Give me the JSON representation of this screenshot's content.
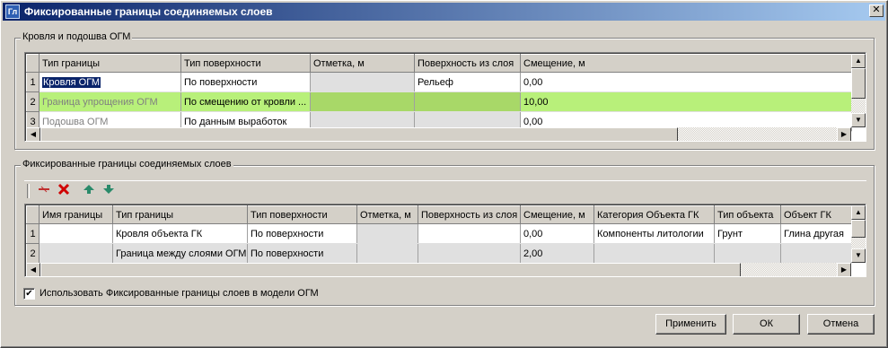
{
  "window": {
    "title": "Фиксированные границы соединяемых слоев",
    "icon_text": "Гл",
    "close_glyph": "✕"
  },
  "group_top": {
    "label": "Кровля и подошва ОГМ",
    "columns": [
      "Тип границы",
      "Тип поверхности",
      "Отметка, м",
      "Поверхность из слоя",
      "Смещение, м"
    ],
    "rows": [
      {
        "num": "1",
        "cells": [
          "Кровля ОГМ",
          "По поверхности",
          "",
          "Рельеф",
          "0,00"
        ]
      },
      {
        "num": "2",
        "cells": [
          "Граница упрощения ОГМ",
          "По смещению от кровли ...",
          "",
          "",
          "10,00"
        ]
      },
      {
        "num": "3",
        "cells": [
          "Подошва ОГМ",
          "По данным выработок",
          "",
          "",
          "0,00"
        ]
      }
    ]
  },
  "group_bottom": {
    "label": "Фиксированные границы соединяемых слоев",
    "toolbar": {
      "delete_row_icon": "delete-row-icon",
      "delete_icon": "delete-icon",
      "move_up_icon": "move-up-icon",
      "move_down_icon": "move-down-icon"
    },
    "columns": [
      "Имя границы",
      "Тип границы",
      "Тип поверхности",
      "Отметка, м",
      "Поверхность из слоя",
      "Смещение, м",
      "Категория Объекта ГК",
      "Тип объекта",
      "Объект ГК"
    ],
    "rows": [
      {
        "num": "1",
        "cells": [
          "",
          "Кровля объекта ГК",
          "По поверхности",
          "",
          "",
          "0,00",
          "Компоненты литологии",
          "Грунт",
          "Глина другая"
        ]
      },
      {
        "num": "2",
        "cells": [
          "",
          "Граница между слоями ОГМ",
          "По поверхности",
          "",
          "",
          "2,00",
          "",
          "",
          ""
        ]
      }
    ]
  },
  "checkbox": {
    "label": "Использовать Фиксированные границы слоев в модели ОГМ",
    "checked": true,
    "glyph": "✔"
  },
  "buttons": {
    "apply": "Применить",
    "ok": "ОК",
    "cancel": "Отмена"
  }
}
